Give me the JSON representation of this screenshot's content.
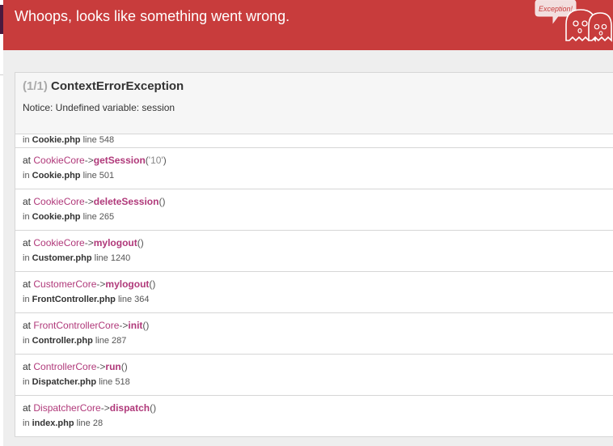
{
  "header": {
    "title": "Whoops, looks like something went wrong.",
    "mascot_text": "Exception!",
    "color": "#c83c3c"
  },
  "exception": {
    "count": "(1/1)",
    "class": "ContextErrorException",
    "message": "Notice: Undefined variable: session"
  },
  "frames": [
    {
      "file": "Cookie.php",
      "line": "line 548"
    },
    {
      "class": "CookieCore",
      "arrow": "->",
      "method": "getSession",
      "open": "(",
      "arg": "'10'",
      "close": ")",
      "file": "Cookie.php",
      "line": "line 501"
    },
    {
      "class": "CookieCore",
      "arrow": "->",
      "method": "deleteSession",
      "open": "(",
      "arg": "",
      "close": ")",
      "file": "Cookie.php",
      "line": "line 265"
    },
    {
      "class": "CookieCore",
      "arrow": "->",
      "method": "mylogout",
      "open": "(",
      "arg": "",
      "close": ")",
      "file": "Customer.php",
      "line": "line 1240"
    },
    {
      "class": "CustomerCore",
      "arrow": "->",
      "method": "mylogout",
      "open": "(",
      "arg": "",
      "close": ")",
      "file": "FrontController.php",
      "line": "line 364"
    },
    {
      "class": "FrontControllerCore",
      "arrow": "->",
      "method": "init",
      "open": "(",
      "arg": "",
      "close": ")",
      "file": "Controller.php",
      "line": "line 287"
    },
    {
      "class": "ControllerCore",
      "arrow": "->",
      "method": "run",
      "open": "(",
      "arg": "",
      "close": ")",
      "file": "Dispatcher.php",
      "line": "line 518"
    },
    {
      "class": "DispatcherCore",
      "arrow": "->",
      "method": "dispatch",
      "open": "(",
      "arg": "",
      "close": ")",
      "file": "index.php",
      "line": "line 28"
    }
  ],
  "labels": {
    "at": "at",
    "in": "in"
  }
}
